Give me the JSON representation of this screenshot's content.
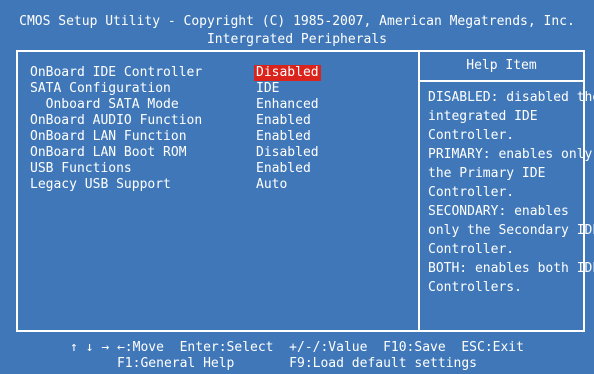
{
  "header": {
    "line1": "CMOS Setup Utility - Copyright (C) 1985-2007, American Megatrends, Inc.",
    "line2": "Intergrated Peripherals"
  },
  "settings": [
    {
      "label": "OnBoard IDE Controller",
      "value": "Disabled",
      "selected": true
    },
    {
      "label": "SATA Configuration",
      "value": "IDE"
    },
    {
      "label": "  Onboard SATA Mode",
      "value": "Enhanced"
    },
    {
      "label": "OnBoard AUDIO Function",
      "value": "Enabled"
    },
    {
      "label": "OnBoard LAN Function",
      "value": "Enabled"
    },
    {
      "label": "OnBoard LAN Boot ROM",
      "value": "Disabled"
    },
    {
      "label": "USB Functions",
      "value": "Enabled"
    },
    {
      "label": "Legacy USB Support",
      "value": "Auto"
    }
  ],
  "help": {
    "title": "Help Item",
    "lines": [
      "DISABLED: disabled the",
      "integrated IDE",
      "Controller.",
      "PRIMARY: enables only",
      "the Primary IDE",
      "Controller.",
      "SECONDARY: enables",
      "only the Secondary IDE",
      "Controller.",
      "BOTH: enables both IDE",
      "Controllers."
    ]
  },
  "footer": {
    "line1": "↑ ↓ → ←:Move  Enter:Select  +/-/:Value  F10:Save  ESC:Exit",
    "line2": "F1:General Help       F9:Load default settings"
  },
  "colors": {
    "background": "#3f77b8",
    "text": "#ffffff",
    "highlight": "#d9231b"
  }
}
